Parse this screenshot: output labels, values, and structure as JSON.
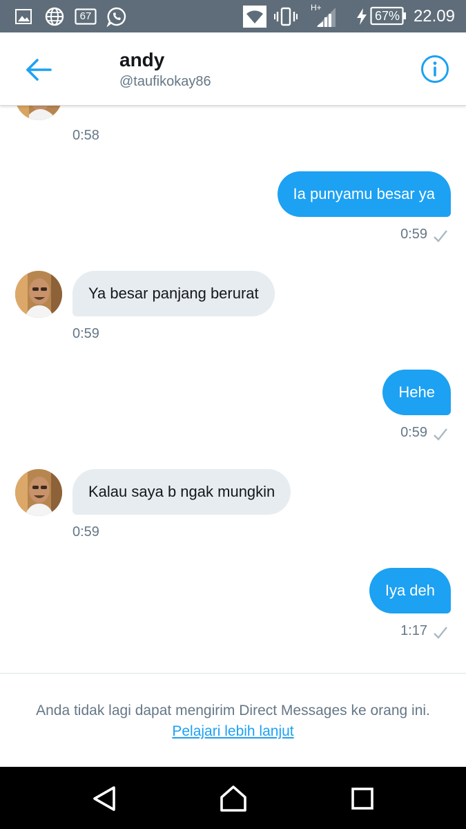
{
  "status_bar": {
    "icons": [
      "gallery-icon",
      "globe-icon",
      "notification-count-icon",
      "whatsapp-icon",
      "wifi-icon",
      "vibrate-icon",
      "signal-icon",
      "charging-icon",
      "battery-icon"
    ],
    "notification_count": "67",
    "network_type": "H+",
    "battery_percent": "67%",
    "time": "22.09"
  },
  "header": {
    "name": "andy",
    "handle": "@taufikokay86",
    "accent_color": "#1da1f2"
  },
  "messages": [
    {
      "direction": "in",
      "text": "",
      "time": "0:58",
      "partial": true
    },
    {
      "direction": "out",
      "text": "Ia punyamu besar ya",
      "time": "0:59",
      "read_check": true
    },
    {
      "direction": "in",
      "text": "Ya besar panjang berurat",
      "time": "0:59"
    },
    {
      "direction": "out",
      "text": "Hehe",
      "time": "0:59",
      "read_check": true
    },
    {
      "direction": "in",
      "text": "Kalau saya b ngak mungkin",
      "time": "0:59"
    },
    {
      "direction": "out",
      "text": "Iya deh",
      "time": "1:17",
      "read_check": true
    }
  ],
  "footer": {
    "notice": "Anda tidak lagi dapat mengirim Direct Messages ke orang ini.",
    "link": "Pelajari lebih lanjut"
  },
  "colors": {
    "status_bar": "#5e6d79",
    "incoming_bubble": "#e6ecf0",
    "outgoing_bubble": "#1da1f2",
    "meta_text": "#657786"
  }
}
